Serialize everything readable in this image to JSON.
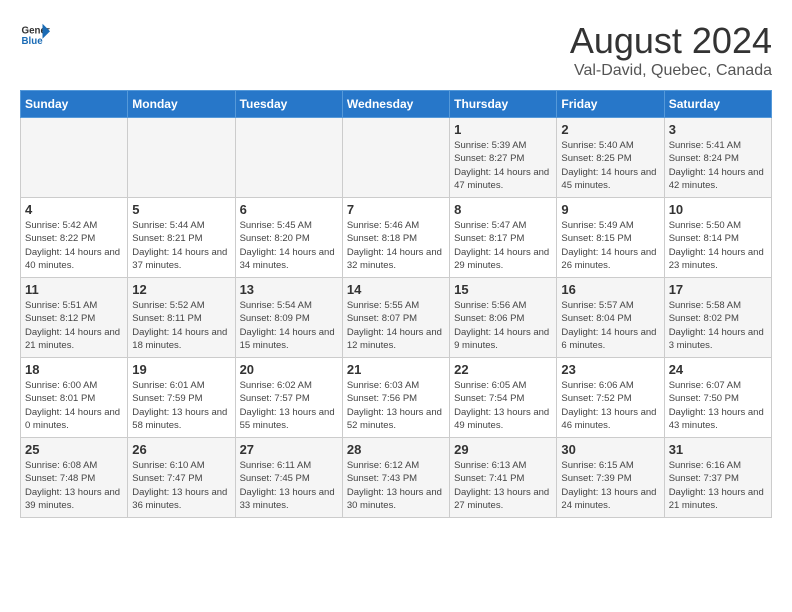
{
  "header": {
    "logo_general": "General",
    "logo_blue": "Blue",
    "title": "August 2024",
    "subtitle": "Val-David, Quebec, Canada"
  },
  "calendar": {
    "days_of_week": [
      "Sunday",
      "Monday",
      "Tuesday",
      "Wednesday",
      "Thursday",
      "Friday",
      "Saturday"
    ],
    "weeks": [
      [
        {
          "day": "",
          "info": ""
        },
        {
          "day": "",
          "info": ""
        },
        {
          "day": "",
          "info": ""
        },
        {
          "day": "",
          "info": ""
        },
        {
          "day": "1",
          "info": "Sunrise: 5:39 AM\nSunset: 8:27 PM\nDaylight: 14 hours\nand 47 minutes."
        },
        {
          "day": "2",
          "info": "Sunrise: 5:40 AM\nSunset: 8:25 PM\nDaylight: 14 hours\nand 45 minutes."
        },
        {
          "day": "3",
          "info": "Sunrise: 5:41 AM\nSunset: 8:24 PM\nDaylight: 14 hours\nand 42 minutes."
        }
      ],
      [
        {
          "day": "4",
          "info": "Sunrise: 5:42 AM\nSunset: 8:22 PM\nDaylight: 14 hours\nand 40 minutes."
        },
        {
          "day": "5",
          "info": "Sunrise: 5:44 AM\nSunset: 8:21 PM\nDaylight: 14 hours\nand 37 minutes."
        },
        {
          "day": "6",
          "info": "Sunrise: 5:45 AM\nSunset: 8:20 PM\nDaylight: 14 hours\nand 34 minutes."
        },
        {
          "day": "7",
          "info": "Sunrise: 5:46 AM\nSunset: 8:18 PM\nDaylight: 14 hours\nand 32 minutes."
        },
        {
          "day": "8",
          "info": "Sunrise: 5:47 AM\nSunset: 8:17 PM\nDaylight: 14 hours\nand 29 minutes."
        },
        {
          "day": "9",
          "info": "Sunrise: 5:49 AM\nSunset: 8:15 PM\nDaylight: 14 hours\nand 26 minutes."
        },
        {
          "day": "10",
          "info": "Sunrise: 5:50 AM\nSunset: 8:14 PM\nDaylight: 14 hours\nand 23 minutes."
        }
      ],
      [
        {
          "day": "11",
          "info": "Sunrise: 5:51 AM\nSunset: 8:12 PM\nDaylight: 14 hours\nand 21 minutes."
        },
        {
          "day": "12",
          "info": "Sunrise: 5:52 AM\nSunset: 8:11 PM\nDaylight: 14 hours\nand 18 minutes."
        },
        {
          "day": "13",
          "info": "Sunrise: 5:54 AM\nSunset: 8:09 PM\nDaylight: 14 hours\nand 15 minutes."
        },
        {
          "day": "14",
          "info": "Sunrise: 5:55 AM\nSunset: 8:07 PM\nDaylight: 14 hours\nand 12 minutes."
        },
        {
          "day": "15",
          "info": "Sunrise: 5:56 AM\nSunset: 8:06 PM\nDaylight: 14 hours\nand 9 minutes."
        },
        {
          "day": "16",
          "info": "Sunrise: 5:57 AM\nSunset: 8:04 PM\nDaylight: 14 hours\nand 6 minutes."
        },
        {
          "day": "17",
          "info": "Sunrise: 5:58 AM\nSunset: 8:02 PM\nDaylight: 14 hours\nand 3 minutes."
        }
      ],
      [
        {
          "day": "18",
          "info": "Sunrise: 6:00 AM\nSunset: 8:01 PM\nDaylight: 14 hours\nand 0 minutes."
        },
        {
          "day": "19",
          "info": "Sunrise: 6:01 AM\nSunset: 7:59 PM\nDaylight: 13 hours\nand 58 minutes."
        },
        {
          "day": "20",
          "info": "Sunrise: 6:02 AM\nSunset: 7:57 PM\nDaylight: 13 hours\nand 55 minutes."
        },
        {
          "day": "21",
          "info": "Sunrise: 6:03 AM\nSunset: 7:56 PM\nDaylight: 13 hours\nand 52 minutes."
        },
        {
          "day": "22",
          "info": "Sunrise: 6:05 AM\nSunset: 7:54 PM\nDaylight: 13 hours\nand 49 minutes."
        },
        {
          "day": "23",
          "info": "Sunrise: 6:06 AM\nSunset: 7:52 PM\nDaylight: 13 hours\nand 46 minutes."
        },
        {
          "day": "24",
          "info": "Sunrise: 6:07 AM\nSunset: 7:50 PM\nDaylight: 13 hours\nand 43 minutes."
        }
      ],
      [
        {
          "day": "25",
          "info": "Sunrise: 6:08 AM\nSunset: 7:48 PM\nDaylight: 13 hours\nand 39 minutes."
        },
        {
          "day": "26",
          "info": "Sunrise: 6:10 AM\nSunset: 7:47 PM\nDaylight: 13 hours\nand 36 minutes."
        },
        {
          "day": "27",
          "info": "Sunrise: 6:11 AM\nSunset: 7:45 PM\nDaylight: 13 hours\nand 33 minutes."
        },
        {
          "day": "28",
          "info": "Sunrise: 6:12 AM\nSunset: 7:43 PM\nDaylight: 13 hours\nand 30 minutes."
        },
        {
          "day": "29",
          "info": "Sunrise: 6:13 AM\nSunset: 7:41 PM\nDaylight: 13 hours\nand 27 minutes."
        },
        {
          "day": "30",
          "info": "Sunrise: 6:15 AM\nSunset: 7:39 PM\nDaylight: 13 hours\nand 24 minutes."
        },
        {
          "day": "31",
          "info": "Sunrise: 6:16 AM\nSunset: 7:37 PM\nDaylight: 13 hours\nand 21 minutes."
        }
      ]
    ]
  }
}
